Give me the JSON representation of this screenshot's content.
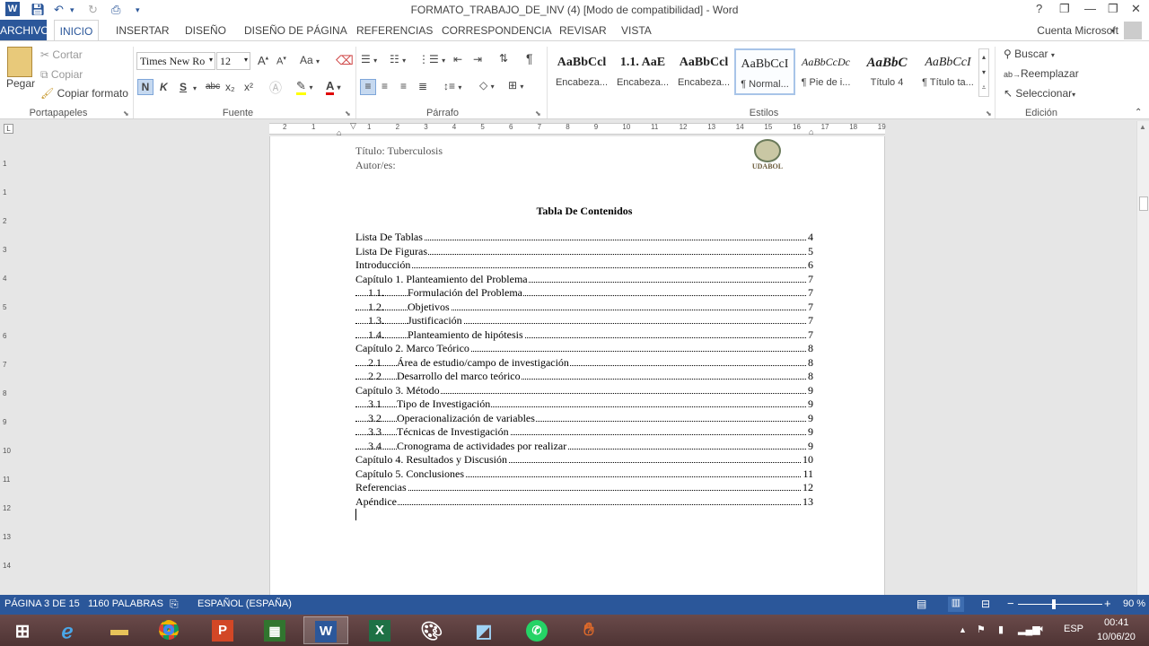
{
  "titlebar": {
    "title": "FORMATO_TRABAJO_DE_INV (4) [Modo de compatibilidad] - Word",
    "help": "?",
    "minimize": "—",
    "restore": "❐",
    "close": "✕"
  },
  "tabs": {
    "archivo": "ARCHIVO",
    "inicio": "INICIO",
    "insertar": "INSERTAR",
    "diseno": "DISEÑO",
    "diseno_pagina": "DISEÑO DE PÁGINA",
    "referencias": "REFERENCIAS",
    "correspondencia": "CORRESPONDENCIA",
    "revisar": "REVISAR",
    "vista": "VISTA",
    "account": "Cuenta Microsoft"
  },
  "ribbon": {
    "clipboard": {
      "paste": "Pegar",
      "cut": "Cortar",
      "copy": "Copiar",
      "format_painter": "Copiar formato",
      "label": "Portapapeles"
    },
    "font": {
      "name": "Times New Ro",
      "size": "12",
      "bold": "N",
      "italic": "K",
      "underline": "S",
      "strike": "abc",
      "subscript": "x₂",
      "superscript": "x²",
      "case": "Aa",
      "grow": "A",
      "shrink": "A",
      "label": "Fuente"
    },
    "paragraph": {
      "pilcrow": "¶",
      "label": "Párrafo"
    },
    "styles": {
      "label": "Estilos",
      "items": [
        {
          "sample": "AaBbCcl",
          "name": "Encabeza..."
        },
        {
          "sample": "1.1.  AaE",
          "name": "Encabeza..."
        },
        {
          "sample": "AaBbCcl",
          "name": "Encabeza..."
        },
        {
          "sample": "AaBbCcI",
          "name": "¶ Normal..."
        },
        {
          "sample": "AaBbCcDc",
          "name": "¶ Pie de i..."
        },
        {
          "sample": "AaBbC",
          "name": "Título 4"
        },
        {
          "sample": "AaBbCcI",
          "name": "¶ Título ta..."
        }
      ]
    },
    "editing": {
      "find": "Buscar",
      "replace": "Reemplazar",
      "select": "Seleccionar",
      "label": "Edición"
    }
  },
  "ruler": {
    "h_left": [
      "2",
      "1"
    ],
    "h_right": [
      "1",
      "2",
      "3",
      "4",
      "5",
      "6",
      "7",
      "8",
      "9",
      "10",
      "11",
      "12",
      "13",
      "14",
      "15",
      "16",
      "17",
      "18",
      "19"
    ],
    "v": [
      "1",
      "1",
      "2",
      "3",
      "4",
      "5",
      "6",
      "7",
      "8",
      "9",
      "10",
      "11",
      "12",
      "13",
      "14"
    ]
  },
  "document": {
    "title_line": "Título: Tuberculosis",
    "author_line": "Autor/es:",
    "logo_text": "UDABOL",
    "heading": "Tabla De Contenidos",
    "toc": [
      {
        "num": "",
        "title": "Lista De Tablas",
        "page": "4",
        "level": 0
      },
      {
        "num": "",
        "title": "Lista De Figuras",
        "page": "5",
        "level": 0
      },
      {
        "num": "",
        "title": "Introducción",
        "page": "6",
        "level": 0
      },
      {
        "num": "",
        "title": "Capítulo 1. Planteamiento del Problema",
        "page": "7",
        "level": 0
      },
      {
        "num": "1.1.",
        "title": "Formulación del Problema",
        "page": "7",
        "level": 1
      },
      {
        "num": "1.2.",
        "title": "Objetivos",
        "page": "7",
        "level": 1
      },
      {
        "num": "1.3.",
        "title": "Justificación",
        "page": "7",
        "level": 1
      },
      {
        "num": "1.4.",
        "title": "Planteamiento de hipótesis",
        "page": "7",
        "level": 1
      },
      {
        "num": "",
        "title": "Capítulo 2. Marco Teórico",
        "page": "8",
        "level": 0
      },
      {
        "num": "2.1",
        "title": "Área de estudio/campo de investigación",
        "page": "8",
        "level": 2
      },
      {
        "num": "2.2",
        "title": "Desarrollo del marco teórico",
        "page": "8",
        "level": 2
      },
      {
        "num": "",
        "title": "Capítulo 3. Método",
        "page": "9",
        "level": 0
      },
      {
        "num": "3.1",
        "title": "Tipo de Investigación",
        "page": "9",
        "level": 2
      },
      {
        "num": "3.2",
        "title": "Operacionalización de variables",
        "page": "9",
        "level": 2
      },
      {
        "num": "3.3",
        "title": "Técnicas de Investigación",
        "page": "9",
        "level": 2
      },
      {
        "num": "3.4",
        "title": "Cronograma de actividades por realizar",
        "page": "9",
        "level": 2
      },
      {
        "num": "",
        "title": "Capítulo 4. Resultados y Discusión",
        "page": "10",
        "level": 0
      },
      {
        "num": "",
        "title": "Capítulo 5. Conclusiones",
        "page": "11",
        "level": 0
      },
      {
        "num": "",
        "title": "Referencias",
        "page": "12",
        "level": 0
      },
      {
        "num": "",
        "title": "Apéndice",
        "page": "13",
        "level": 0
      }
    ]
  },
  "status": {
    "page": "PÁGINA 3 DE 15",
    "words": "1160 PALABRAS",
    "language": "ESPAÑOL (ESPAÑA)",
    "zoom": "90 %",
    "zoom_minus": "−",
    "zoom_plus": "+"
  },
  "taskbar": {
    "apps": [
      "ie-icon",
      "explorer-icon",
      "chrome-icon",
      "powerpoint-icon",
      "project-icon",
      "word-icon",
      "excel-icon",
      "paint-icon",
      "notes-icon",
      "whatsapp-icon",
      "app-icon"
    ],
    "ppt_letter": "P",
    "word_letter": "W",
    "excel_letter": "X",
    "lang": "ESP",
    "time": "00:41",
    "date": "10/06/20"
  },
  "colors": {
    "accent": "#2b579a",
    "taskbar": "#5a3a3a"
  }
}
